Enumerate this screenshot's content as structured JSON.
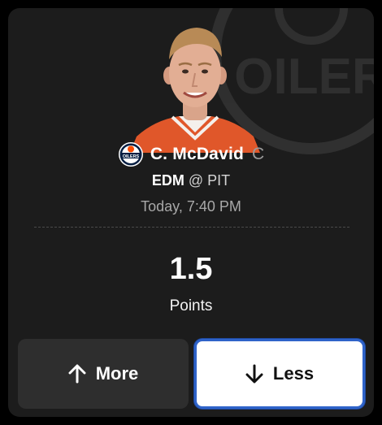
{
  "player": {
    "name": "C. McDavid",
    "position": "C"
  },
  "game": {
    "team": "EDM",
    "at_symbol": "@",
    "opponent": "PIT",
    "time": "Today, 7:40 PM"
  },
  "projection": {
    "line": "1.5",
    "stat": "Points"
  },
  "buttons": {
    "more_label": "More",
    "less_label": "Less",
    "selected": "less"
  },
  "icons": {
    "team_logo": "oilers-logo-icon",
    "watermark": "oilers-watermark-icon",
    "more": "arrow-up-icon",
    "less": "arrow-down-icon"
  },
  "colors": {
    "card_background": "#1c1c1c",
    "selected_border": "#2f63c9",
    "oilers_blue": "#041e42",
    "oilers_orange": "#fc4c02"
  }
}
